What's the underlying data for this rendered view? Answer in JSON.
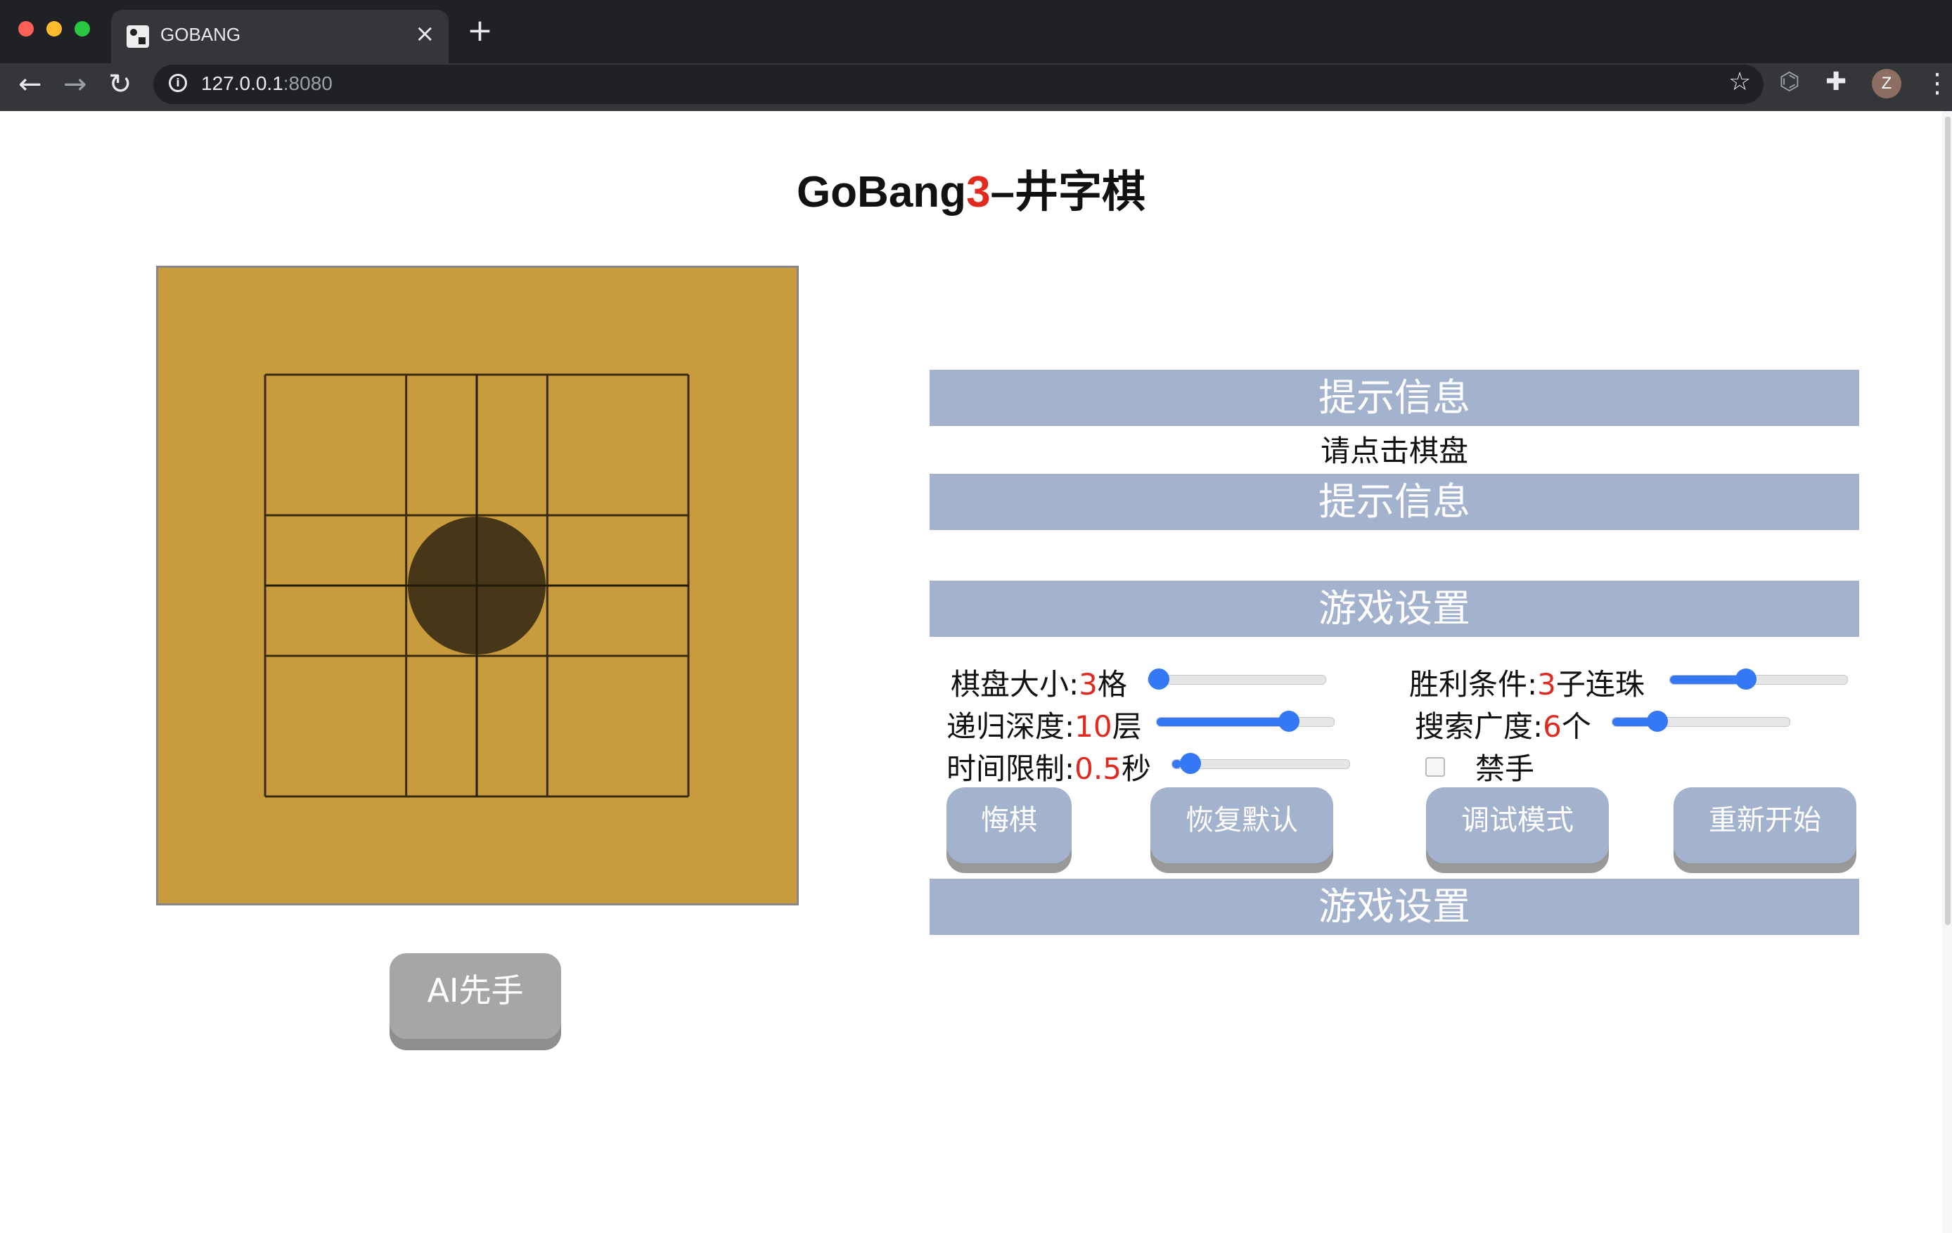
{
  "browser": {
    "tab_title": "GOBANG",
    "tab_close": "×",
    "new_tab": "+",
    "url_host": "127.0.0.1",
    "url_port": ":8080",
    "avatar_letter": "Z",
    "icons": [
      "back-arrow-icon",
      "forward-arrow-icon",
      "reload-icon",
      "info-icon",
      "star-icon",
      "puzzle-icon",
      "menu-icon"
    ]
  },
  "page": {
    "title_prefix": "GoBang",
    "title_number": "3",
    "title_suffix": "–井字棋"
  },
  "board": {
    "size": 3,
    "stones": [
      {
        "row": 1,
        "col": 1,
        "color": "#3d2f16"
      }
    ],
    "background": "#c89c3d"
  },
  "ai_first_button": "AI先手",
  "hint": {
    "header": "提示信息",
    "text": "请点击棋盘",
    "footer": "提示信息"
  },
  "settings": {
    "header": "游戏设置",
    "footer": "游戏设置",
    "board_size": {
      "label": "棋盘大小:",
      "value": "3",
      "unit": "格",
      "fraction": 0.0
    },
    "win_condition": {
      "label": "胜利条件:",
      "value": "3",
      "unit": "子连珠",
      "fraction": 0.42
    },
    "depth": {
      "label": "递归深度:",
      "value": "10",
      "unit": "层",
      "fraction": 0.78
    },
    "breadth": {
      "label": "搜索广度:",
      "value": "6",
      "unit": "个",
      "fraction": 0.22
    },
    "time_limit": {
      "label": "时间限制:",
      "value": "0.5",
      "unit": "秒",
      "fraction": 0.05
    },
    "forbidden": {
      "label": "禁手",
      "checked": false
    }
  },
  "buttons": {
    "undo": "悔棋",
    "reset_default": "恢复默认",
    "debug_mode": "调试模式",
    "restart": "重新开始"
  },
  "colors": {
    "accent_red": "#e02a20",
    "bar": "#a4b3cd",
    "slider": "#3478f6"
  }
}
